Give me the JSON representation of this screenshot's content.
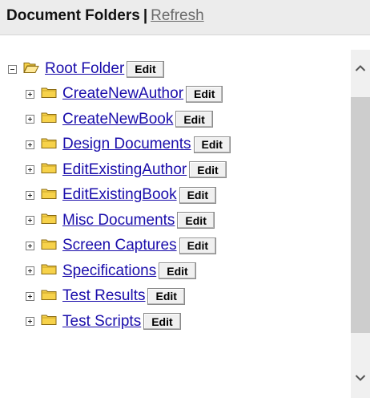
{
  "header": {
    "title": "Document Folders",
    "separator": "|",
    "refresh_label": "Refresh"
  },
  "tree": {
    "root": {
      "label": "Root Folder",
      "edit_label": "Edit",
      "expanded": true
    },
    "children": [
      {
        "label": "CreateNewAuthor",
        "edit_label": "Edit"
      },
      {
        "label": "CreateNewBook",
        "edit_label": "Edit"
      },
      {
        "label": "Design Documents",
        "edit_label": "Edit"
      },
      {
        "label": "EditExistingAuthor",
        "edit_label": "Edit"
      },
      {
        "label": "EditExistingBook",
        "edit_label": "Edit"
      },
      {
        "label": "Misc Documents",
        "edit_label": "Edit"
      },
      {
        "label": "Screen Captures",
        "edit_label": "Edit"
      },
      {
        "label": "Specifications",
        "edit_label": "Edit"
      },
      {
        "label": "Test Results",
        "edit_label": "Edit"
      },
      {
        "label": "Test Scripts",
        "edit_label": "Edit"
      }
    ]
  },
  "icons": {
    "root": "folder-open-icon",
    "child": "folder-closed-icon",
    "scroll_up": "chevron-up-icon",
    "scroll_down": "chevron-down-icon"
  },
  "colors": {
    "link": "#1a0dab",
    "header_bg": "#ececec",
    "folder_fill": "#f7d24a",
    "folder_stroke": "#8a6a10"
  }
}
